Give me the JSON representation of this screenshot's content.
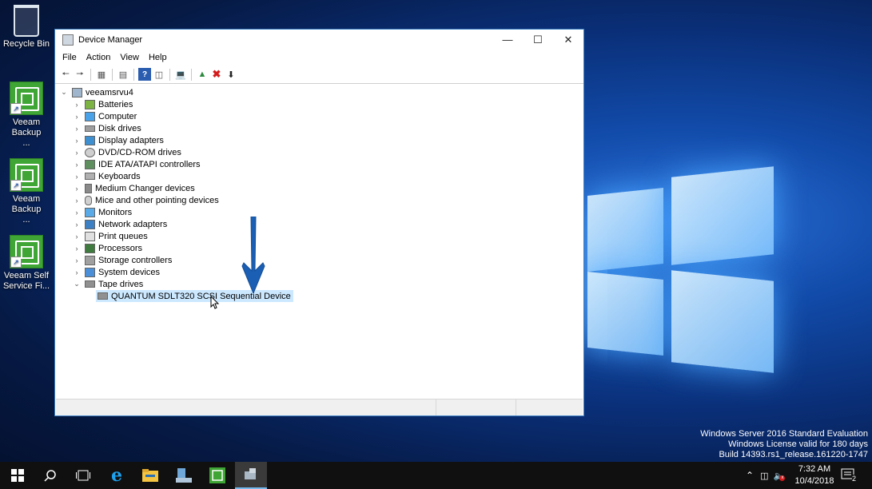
{
  "desktop": {
    "icons": [
      {
        "label": "Recycle Bin"
      },
      {
        "label": "Veeam Backup ..."
      },
      {
        "label": "Veeam Backup ..."
      },
      {
        "label": "Veeam Self Service Fi..."
      }
    ],
    "watermark": {
      "line1": "Windows Server 2016 Standard Evaluation",
      "line2": "Windows License valid for 180 days",
      "line3": "Build 14393.rs1_release.161220-1747"
    }
  },
  "window": {
    "title": "Device Manager",
    "menu": [
      "File",
      "Action",
      "View",
      "Help"
    ],
    "tree": {
      "root": "veeamsrvu4",
      "categories": [
        {
          "label": "Batteries",
          "expanded": false
        },
        {
          "label": "Computer",
          "expanded": false
        },
        {
          "label": "Disk drives",
          "expanded": false
        },
        {
          "label": "Display adapters",
          "expanded": false
        },
        {
          "label": "DVD/CD-ROM drives",
          "expanded": false
        },
        {
          "label": "IDE ATA/ATAPI controllers",
          "expanded": false
        },
        {
          "label": "Keyboards",
          "expanded": false
        },
        {
          "label": "Medium Changer devices",
          "expanded": false
        },
        {
          "label": "Mice and other pointing devices",
          "expanded": false
        },
        {
          "label": "Monitors",
          "expanded": false
        },
        {
          "label": "Network adapters",
          "expanded": false
        },
        {
          "label": "Print queues",
          "expanded": false
        },
        {
          "label": "Processors",
          "expanded": false
        },
        {
          "label": "Storage controllers",
          "expanded": false
        },
        {
          "label": "System devices",
          "expanded": false
        },
        {
          "label": "Tape drives",
          "expanded": true
        }
      ],
      "selected_device": "QUANTUM SDLT320 SCSI Sequential Device"
    }
  },
  "taskbar": {
    "clock_time": "7:32 AM",
    "clock_date": "10/4/2018",
    "notification_count": "2"
  },
  "colors": {
    "selection": "#cce8ff",
    "arrow": "#1a5fb4",
    "accent": "#0078d7"
  }
}
